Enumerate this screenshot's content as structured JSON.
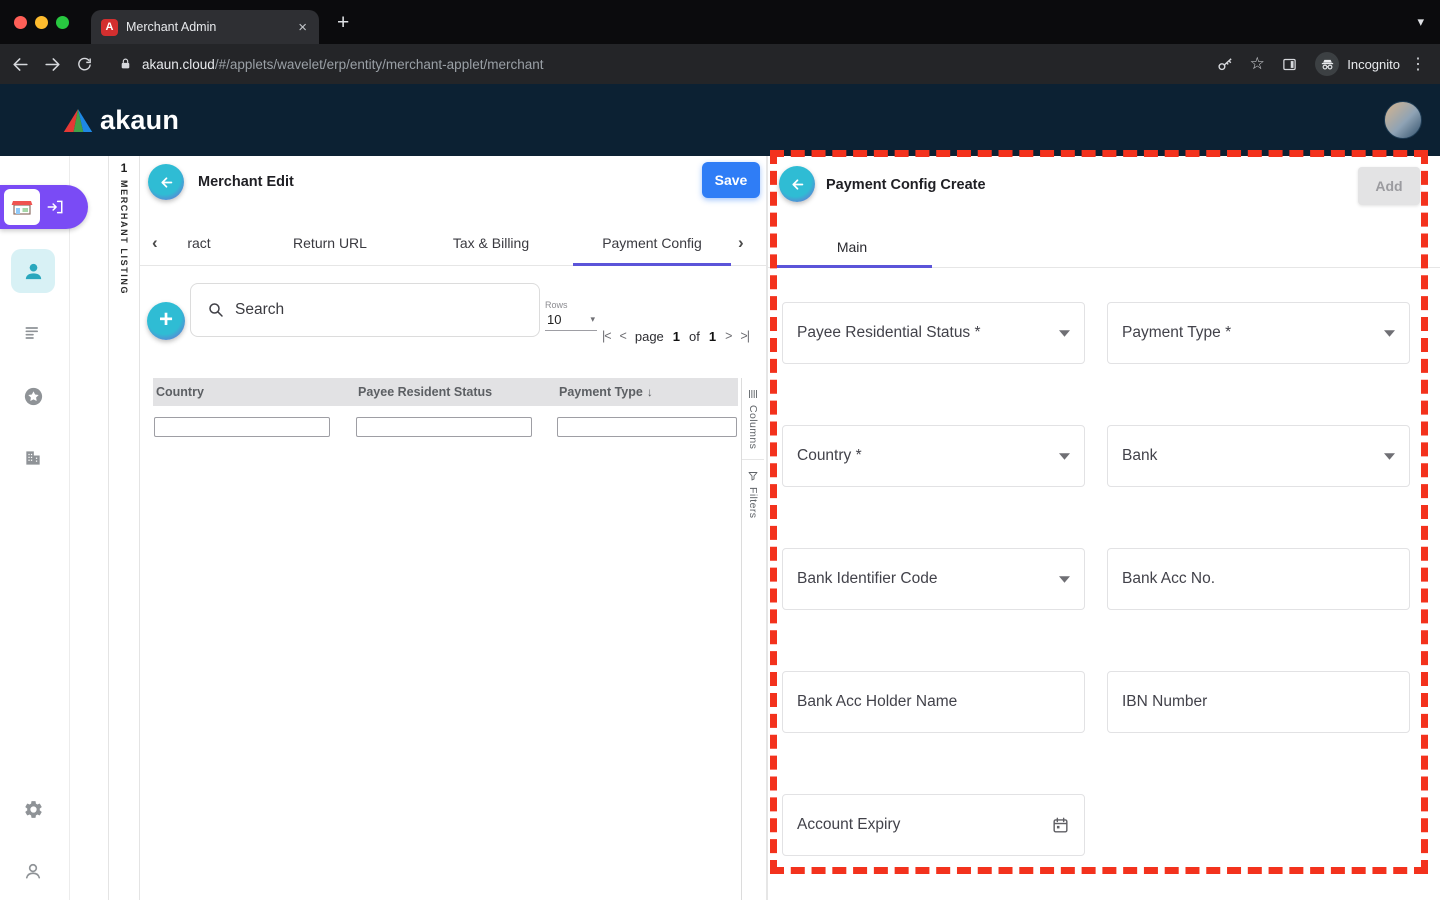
{
  "browser": {
    "tab_title": "Merchant Admin",
    "url_host": "akaun.cloud",
    "url_path": "/#/applets/wavelet/erp/entity/merchant-applet/merchant",
    "incognito_label": "Incognito"
  },
  "header": {
    "logo_text": "akaun"
  },
  "sidebar": {
    "items": [
      "merchant-store",
      "account",
      "list",
      "star-circle",
      "organization",
      "settings",
      "support"
    ]
  },
  "left_panel": {
    "vertical_tab": {
      "number": "1",
      "label": "MERCHANT LISTING"
    },
    "title": "Merchant Edit",
    "save_label": "Save",
    "tabs": [
      "ract",
      "Return URL",
      "Tax & Billing",
      "Payment Config"
    ],
    "active_tab": "Payment Config",
    "search_placeholder": "Search",
    "rows_label": "Rows",
    "rows_value": "10",
    "pagination": {
      "page_label": "page",
      "current": "1",
      "of_label": "of",
      "total": "1"
    },
    "table": {
      "columns": [
        "Country",
        "Payee Resident Status",
        "Payment Type"
      ],
      "sorted_column": "Payment Type",
      "sort_direction": "desc"
    },
    "side_tabs": [
      "Columns",
      "Filters"
    ]
  },
  "right_panel": {
    "title": "Payment Config Create",
    "add_label": "Add",
    "tab_main": "Main",
    "fields": [
      {
        "label": "Payee Residential Status *",
        "type": "select"
      },
      {
        "label": "Payment Type *",
        "type": "select"
      },
      {
        "label": "Country *",
        "type": "select"
      },
      {
        "label": "Bank",
        "type": "select"
      },
      {
        "label": "Bank Identifier Code",
        "type": "select"
      },
      {
        "label": "Bank Acc No.",
        "type": "text"
      },
      {
        "label": "Bank Acc Holder Name",
        "type": "text"
      },
      {
        "label": "IBN Number",
        "type": "text"
      },
      {
        "label": "Account Expiry",
        "type": "date"
      }
    ]
  },
  "icons": {
    "close": "×",
    "new_tab": "+",
    "tabs_chevron": "▾",
    "star": "☆",
    "menu_dots": "⋮",
    "tab_left": "‹",
    "tab_right": "›",
    "plus": "+",
    "caret_down": "▾",
    "sort_desc": "↓",
    "pag_first": "|<",
    "pag_prev": "<",
    "pag_next": ">",
    "pag_last": ">|"
  },
  "colors": {
    "header_navy": "#0c2133",
    "accent_teal": "#2fbcd4",
    "accent_purple": "#7a4bf5",
    "tab_underline": "#5b54d9",
    "save_blue": "#2f7df6",
    "annotation_red": "#f3321d"
  }
}
